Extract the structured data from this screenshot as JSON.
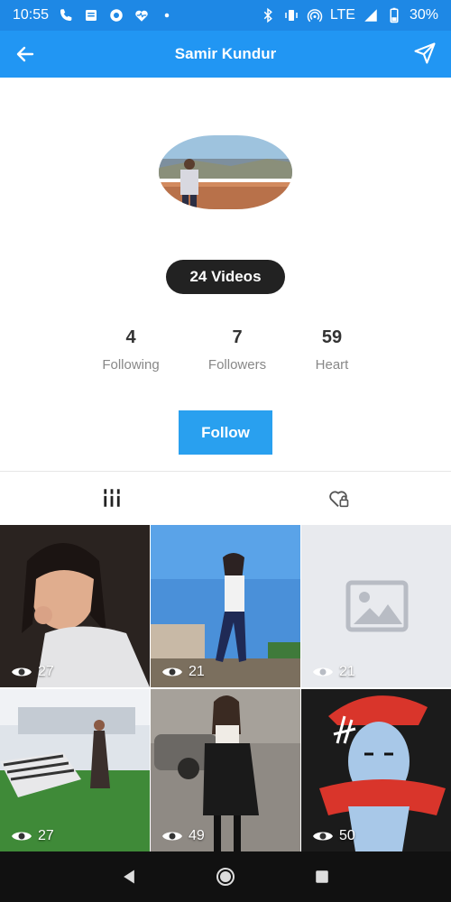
{
  "status_bar": {
    "time": "10:55",
    "network": "LTE",
    "battery": "30%"
  },
  "app_bar": {
    "title": "Samir Kundur"
  },
  "profile": {
    "videos_label": "24 Videos",
    "stats": [
      {
        "value": "4",
        "label": "Following"
      },
      {
        "value": "7",
        "label": "Followers"
      },
      {
        "value": "59",
        "label": "Heart"
      }
    ],
    "follow_label": "Follow"
  },
  "tabs": [
    {
      "icon": "videos-grid-icon"
    },
    {
      "icon": "liked-lock-icon"
    }
  ],
  "videos": [
    {
      "views": "27"
    },
    {
      "views": "21"
    },
    {
      "views": "21"
    },
    {
      "views": "27"
    },
    {
      "views": "49"
    },
    {
      "views": "50"
    }
  ],
  "colors": {
    "status_bar": "#1e88e5",
    "app_bar": "#2196f3",
    "follow_button": "#29a0ef",
    "pill": "#222222"
  }
}
